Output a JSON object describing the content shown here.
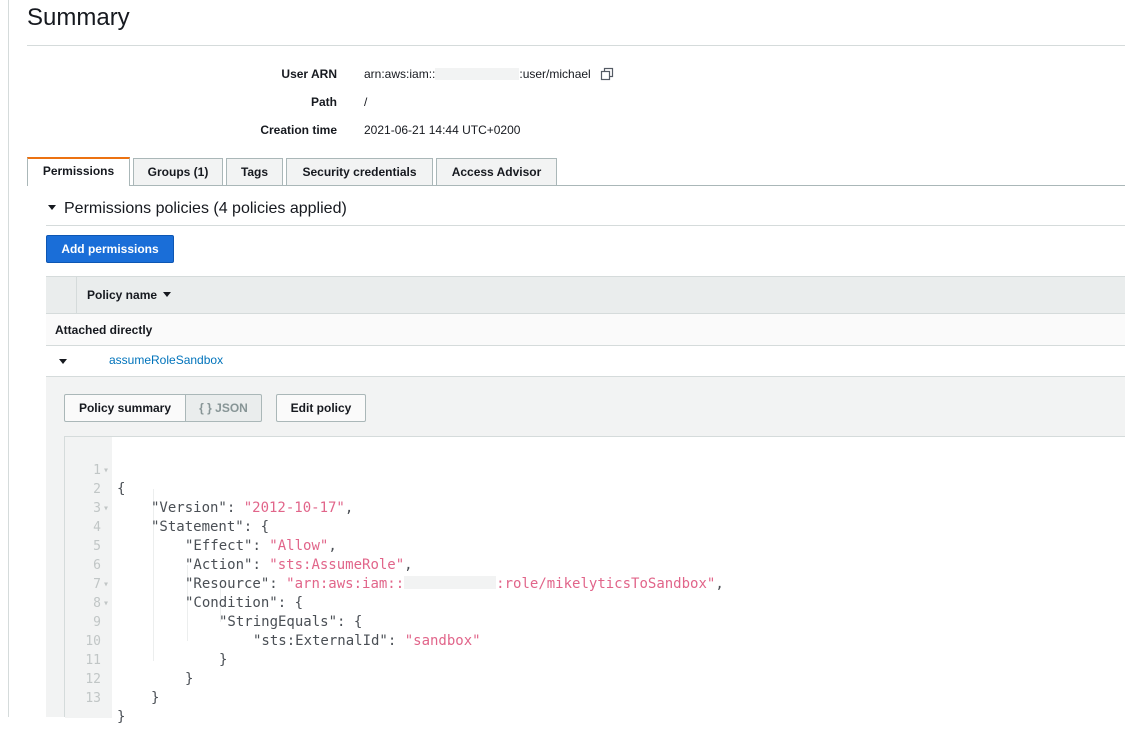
{
  "page": {
    "title": "Summary"
  },
  "summary": {
    "user_arn": {
      "label": "User ARN",
      "prefix": "arn:aws:iam::",
      "suffix": ":user/michael"
    },
    "path": {
      "label": "Path",
      "value": "/"
    },
    "creation_time": {
      "label": "Creation time",
      "value": "2021-06-21 14:44 UTC+0200"
    },
    "copy_icon": "copy-icon"
  },
  "tabs": [
    {
      "label": "Permissions",
      "active": true
    },
    {
      "label": "Groups (1)",
      "active": false
    },
    {
      "label": "Tags",
      "active": false
    },
    {
      "label": "Security credentials",
      "active": false
    },
    {
      "label": "Access Advisor",
      "active": false
    }
  ],
  "permissions": {
    "section_title": "Permissions policies (4 policies applied)",
    "add_button": "Add permissions",
    "table": {
      "column_header": "Policy name",
      "group_label": "Attached directly",
      "policy_name": "assumeRoleSandbox"
    },
    "detail": {
      "seg_summary": "Policy summary",
      "seg_json": "{ } JSON",
      "edit_button": "Edit policy"
    }
  },
  "code": {
    "line_numbers": [
      "1",
      "2",
      "3",
      "4",
      "5",
      "6",
      "7",
      "8",
      "9",
      "10",
      "11",
      "12",
      "13"
    ],
    "open_brace": "{",
    "version_key": "\"Version\"",
    "version_value": "\"2012-10-17\"",
    "statement_key": "\"Statement\"",
    "effect_key": "\"Effect\"",
    "effect_value": "\"Allow\"",
    "action_key": "\"Action\"",
    "action_value": "\"sts:AssumeRole\"",
    "resource_key": "\"Resource\"",
    "resource_prefix": "\"arn:aws:iam::",
    "resource_suffix": ":role/mikelyticsToSandbox\"",
    "condition_key": "\"Condition\"",
    "stringequals_key": "\"StringEquals\"",
    "externalid_key": "\"sts:ExternalId\"",
    "externalid_value": "\"sandbox\"",
    "close_brace": "}"
  },
  "colors": {
    "accent_tab": "#ec7211",
    "primary_button": "#1a6ed8",
    "link": "#0073bb",
    "json_string": "#e1658a"
  }
}
